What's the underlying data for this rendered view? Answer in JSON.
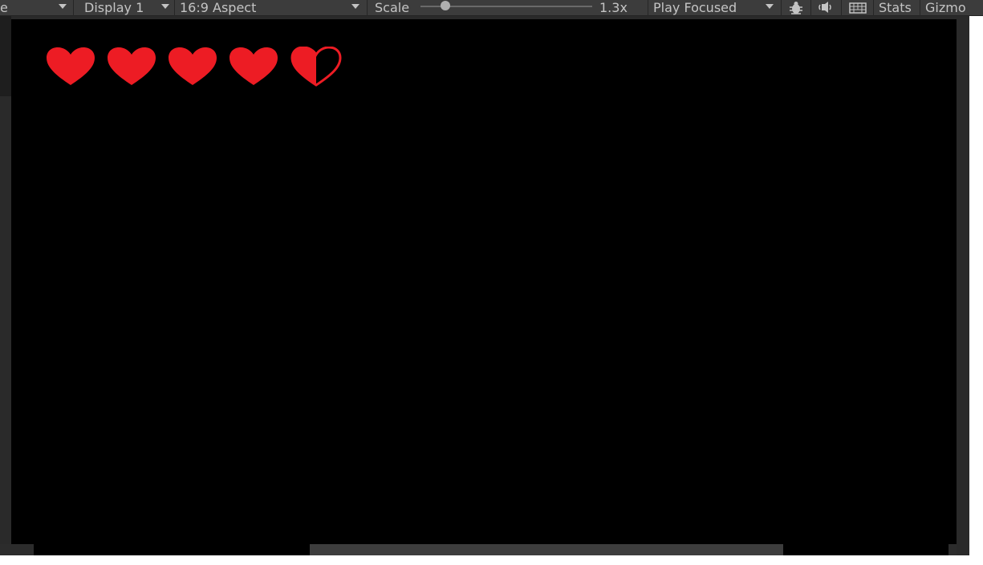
{
  "toolbar": {
    "view_dropdown_label": "e",
    "display_label": "Display 1",
    "aspect_label": "16:9 Aspect",
    "scale_label": "Scale",
    "scale_value": "1.3x",
    "scale_slider_level": 0.15,
    "play_mode_label": "Play Focused",
    "stats_label": "Stats",
    "gizmos_label": "Gizmo"
  },
  "hud": {
    "hearts": [
      {
        "fill": 1.0
      },
      {
        "fill": 1.0
      },
      {
        "fill": 1.0
      },
      {
        "fill": 1.0
      },
      {
        "fill": 0.5
      }
    ],
    "heart_color": "#ed1c24"
  },
  "colors": {
    "toolbar_bg": "#3c3c3c",
    "game_bg": "#000000",
    "text": "#c4c4c4"
  },
  "icons": {
    "debug": "bug-icon",
    "audio": "speaker-icon",
    "keyboard": "keyboard-icon"
  }
}
